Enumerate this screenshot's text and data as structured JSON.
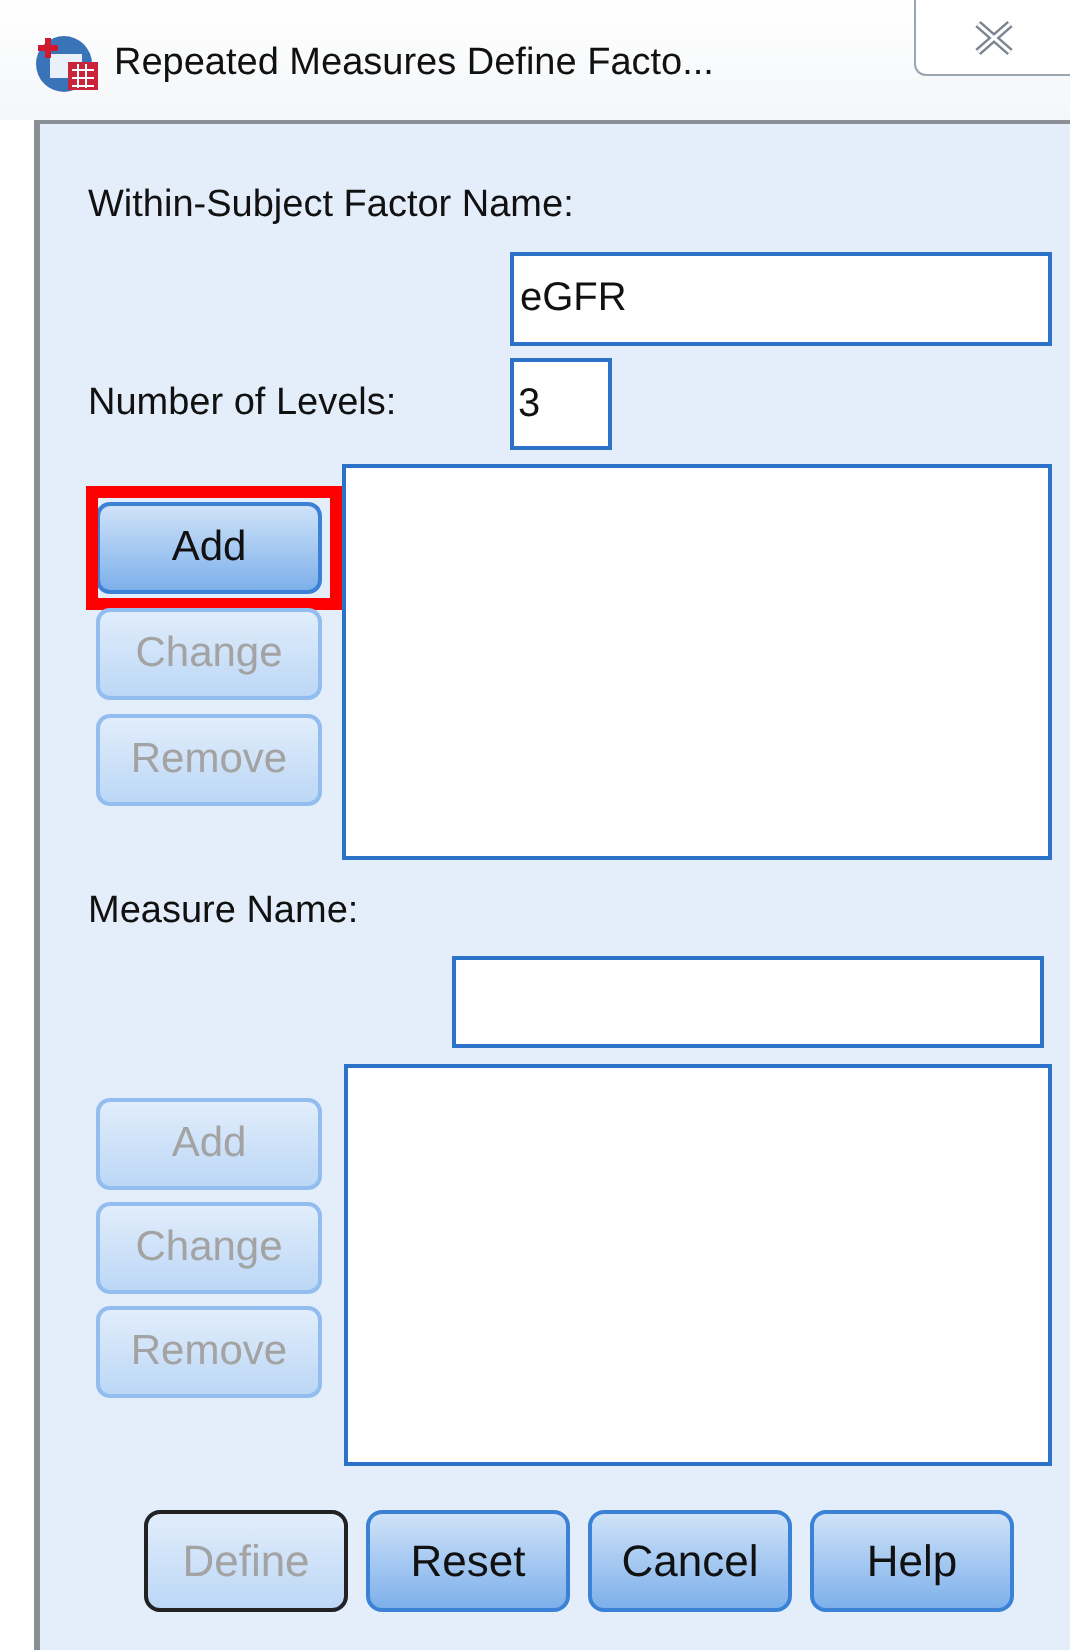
{
  "window": {
    "title": "Repeated Measures Define Facto..."
  },
  "factor": {
    "label": "Within-Subject Factor Name:",
    "value": "eGFR"
  },
  "levels": {
    "label": "Number of Levels:",
    "value": "3"
  },
  "factor_buttons": [
    {
      "label": "Add",
      "disabled": false,
      "highlighted": true
    },
    {
      "label": "Change",
      "disabled": true,
      "highlighted": false
    },
    {
      "label": "Remove",
      "disabled": true,
      "highlighted": false
    }
  ],
  "measure": {
    "label": "Measure Name:"
  },
  "measure_buttons": [
    {
      "label": "Add",
      "disabled": true,
      "highlighted": false
    },
    {
      "label": "Change",
      "disabled": true,
      "highlighted": false
    },
    {
      "label": "Remove",
      "disabled": true,
      "highlighted": false
    }
  ],
  "footer_buttons": [
    {
      "label": "Define",
      "disabled": true,
      "default": true
    },
    {
      "label": "Reset",
      "disabled": false,
      "default": false
    },
    {
      "label": "Cancel",
      "disabled": false,
      "default": false
    },
    {
      "label": "Help",
      "disabled": false,
      "default": false
    }
  ]
}
